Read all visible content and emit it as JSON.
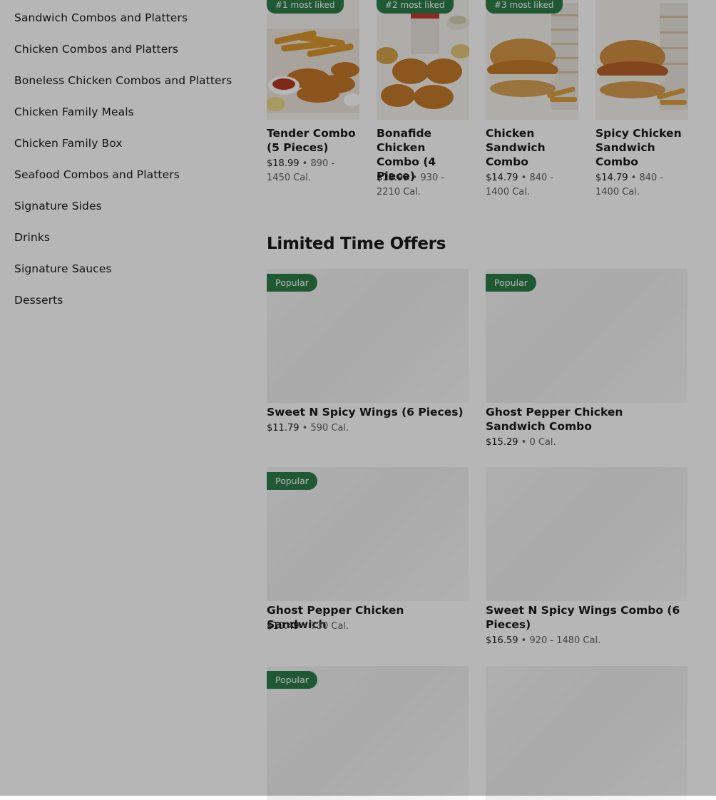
{
  "sidebar": {
    "items": [
      {
        "label": "Sandwich Combos and Platters"
      },
      {
        "label": "Chicken Combos and Platters"
      },
      {
        "label": "Boneless Chicken Combos and Platters"
      },
      {
        "label": "Chicken Family Meals"
      },
      {
        "label": "Chicken Family Box"
      },
      {
        "label": "Seafood Combos and Platters"
      },
      {
        "label": "Signature Sides"
      },
      {
        "label": "Drinks"
      },
      {
        "label": "Signature Sauces"
      },
      {
        "label": "Desserts"
      }
    ]
  },
  "featured": {
    "items": [
      {
        "badge": "#1 most liked",
        "name": "Tender Combo (5 Pieces)",
        "price": "$18.99",
        "sep": " • ",
        "cal": "890 - 1450 Cal."
      },
      {
        "badge": "#2 most liked",
        "name": "Bonafide Chicken Combo (4 Piece)",
        "price": "$18.99",
        "sep": " • ",
        "cal": "930 - 2210 Cal."
      },
      {
        "badge": "#3 most liked",
        "name": "Chicken Sandwich Combo",
        "price": "$14.79",
        "sep": " • ",
        "cal": "840 - 1400 Cal."
      },
      {
        "badge": "",
        "name": "Spicy Chicken Sandwich Combo",
        "price": "$14.79",
        "sep": " • ",
        "cal": "840 - 1400 Cal."
      }
    ]
  },
  "limited": {
    "title": "Limited Time Offers",
    "items": [
      {
        "badge": "Popular",
        "name": "Sweet N Spicy Wings (6 Pieces)",
        "price": "$11.79",
        "sep": " • ",
        "cal": "590 Cal."
      },
      {
        "badge": "Popular",
        "name": "Ghost Pepper Chicken Sandwich Combo",
        "price": "$15.29",
        "sep": " • ",
        "cal": "0 Cal."
      },
      {
        "badge": "Popular",
        "name": "Ghost Pepper Chicken Sandwich",
        "price": "$10.49",
        "sep": " • ",
        "cal": "730 Cal."
      },
      {
        "badge": "",
        "name": "Sweet N Spicy Wings Combo (6 Pieces)",
        "price": "$16.59",
        "sep": " • ",
        "cal": "920 - 1480 Cal."
      },
      {
        "badge": "Popular",
        "name": "",
        "price": "",
        "sep": "",
        "cal": ""
      },
      {
        "badge": "",
        "name": "",
        "price": "",
        "sep": "",
        "cal": ""
      }
    ]
  },
  "colors": {
    "badge": "#2c7d49",
    "overlay": "rgba(0,0,0,0.285)"
  },
  "icons": {
    "featured_images": [
      "tender-combo-photo",
      "bonafide-combo-photo",
      "chicken-sandwich-combo-photo",
      "spicy-sandwich-combo-photo"
    ]
  }
}
